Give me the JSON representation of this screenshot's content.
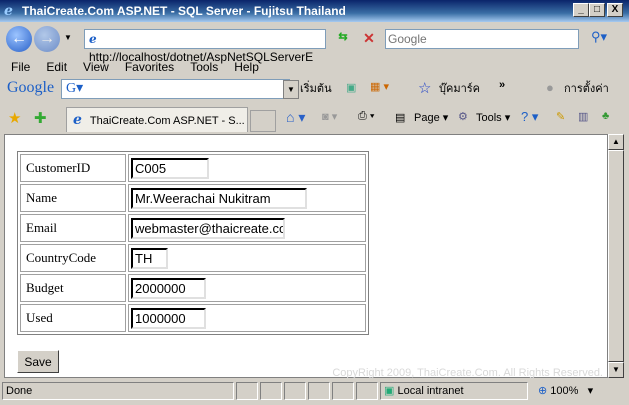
{
  "window": {
    "title": "ThaiCreate.Com ASP.NET - SQL Server - Fujitsu Thailand",
    "min": "_",
    "max": "□",
    "close": "X"
  },
  "address": {
    "url": "http://localhost/dotnet/AspNetSQLServerE",
    "search_placeholder": "Google"
  },
  "menu": [
    "File",
    "Edit",
    "View",
    "Favorites",
    "Tools",
    "Help"
  ],
  "google_toolbar": {
    "logo": "Google",
    "start": "เริ่มต้น",
    "bookmarks": "บุ๊คมาร์ค",
    "more": "»",
    "settings": "การตั้งค่า"
  },
  "tab": {
    "label": "ThaiCreate.Com ASP.NET - S..."
  },
  "command_bar": {
    "page": "Page",
    "tools": "Tools"
  },
  "form": {
    "rows": [
      {
        "label": "CustomerID",
        "value": "C005"
      },
      {
        "label": "Name",
        "value": "Mr.Weerachai Nukitram"
      },
      {
        "label": "Email",
        "value": "webmaster@thaicreate.com"
      },
      {
        "label": "CountryCode",
        "value": "TH"
      },
      {
        "label": "Budget",
        "value": "2000000"
      },
      {
        "label": "Used",
        "value": "1000000"
      }
    ],
    "save_label": "Save"
  },
  "copyright": "CopyRight 2009, ThaiCreate.Com. All Rights Reserved.",
  "status": {
    "text": "Done",
    "zone": "Local intranet",
    "zoom": "100%"
  }
}
